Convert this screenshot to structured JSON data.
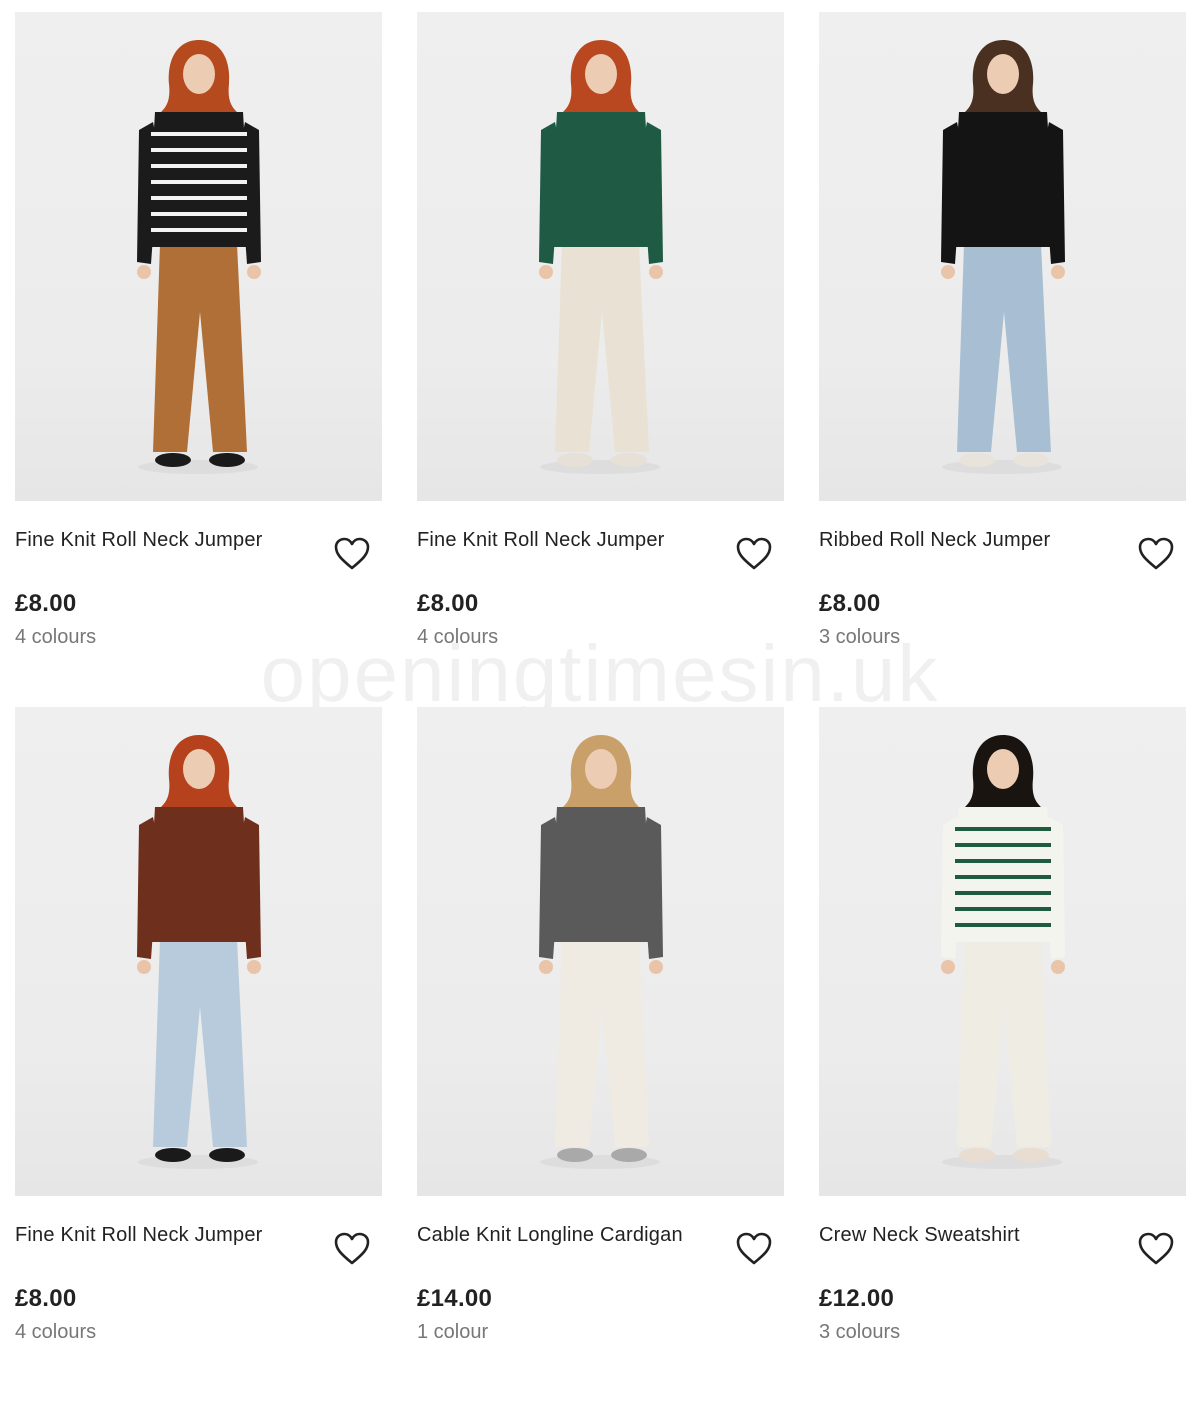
{
  "watermark": "openingtimesin.uk",
  "products": [
    {
      "title": "Fine Knit Roll Neck Jumper",
      "price": "£8.00",
      "colours": "4 colours",
      "image": "model-striped-black-jumper",
      "top": "#1b1b1b",
      "stripe": "#f3f3f3",
      "bottom": "#b06f36",
      "hair": "#b44a1e",
      "shoes": "#1a1a1a"
    },
    {
      "title": "Fine Knit Roll Neck Jumper",
      "price": "£8.00",
      "colours": "4 colours",
      "image": "model-green-jumper",
      "top": "#1f5a45",
      "stripe": "",
      "bottom": "#e9e2d4",
      "hair": "#b9471f",
      "shoes": "#e6e0d6"
    },
    {
      "title": "Ribbed Roll Neck Jumper",
      "price": "£8.00",
      "colours": "3 colours",
      "image": "model-black-ribbed-jumper",
      "top": "#141414",
      "stripe": "",
      "bottom": "#a8bfd3",
      "hair": "#4a3020",
      "shoes": "#e8e4dc"
    },
    {
      "title": "Fine Knit Roll Neck Jumper",
      "price": "£8.00",
      "colours": "4 colours",
      "image": "model-brown-jumper",
      "top": "#6e2f1d",
      "stripe": "",
      "bottom": "#b8cbdc",
      "hair": "#b5421c",
      "shoes": "#1a1a1a"
    },
    {
      "title": "Cable Knit Longline Cardigan",
      "price": "£14.00",
      "colours": "1 colour",
      "image": "model-grey-cardigan",
      "top": "#5a5a5a",
      "stripe": "",
      "bottom": "#efebe2",
      "hair": "#c9a06a",
      "shoes": "#a9a9a9"
    },
    {
      "title": "Crew Neck Sweatshirt",
      "price": "£12.00",
      "colours": "3 colours",
      "image": "model-green-striped-sweatshirt",
      "top": "#f4f4ef",
      "stripe": "#1d5c3f",
      "bottom": "#efece4",
      "hair": "#1a1411",
      "shoes": "#e8ddd0"
    }
  ],
  "colors": {
    "text": "#222222",
    "muted": "#777777",
    "photo_bg": "#ececec"
  },
  "icons": {
    "wishlist": "heart-outline-icon"
  }
}
